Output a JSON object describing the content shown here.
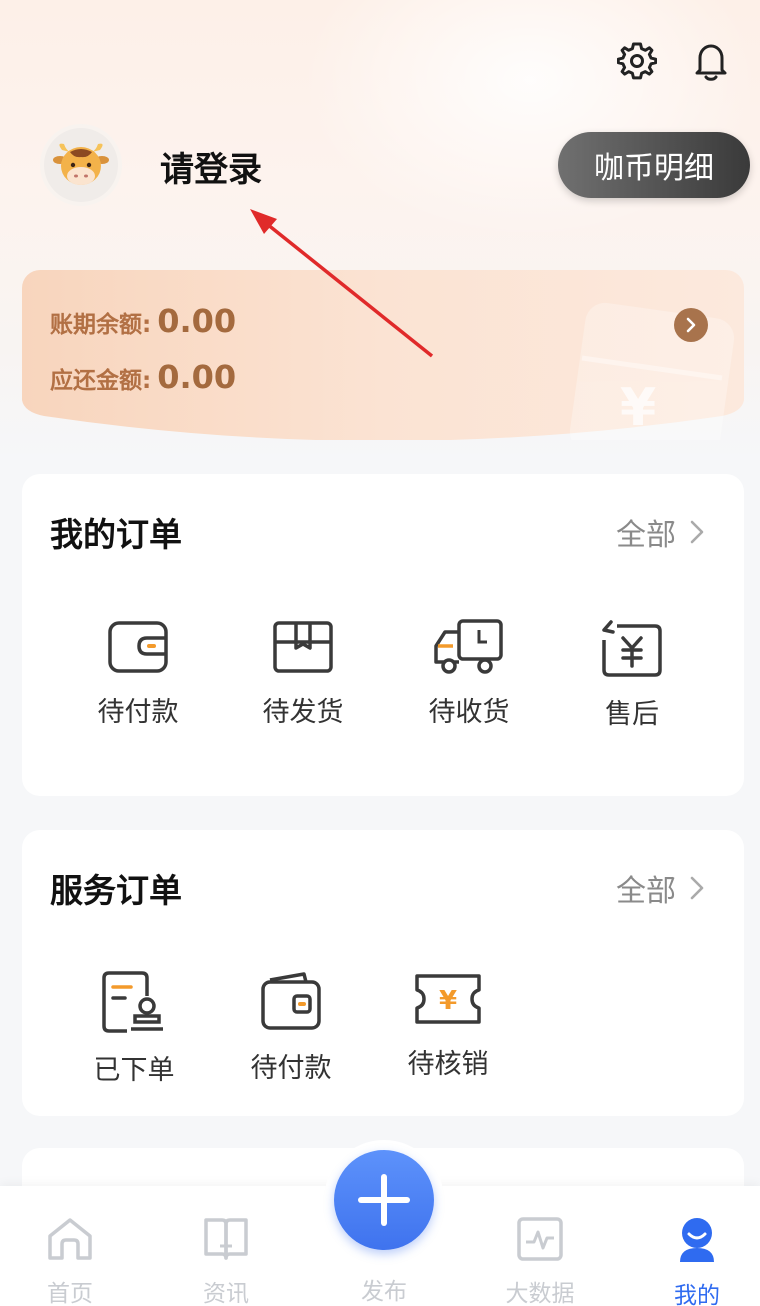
{
  "header": {
    "settings_icon": "gear-icon",
    "notification_icon": "bell-icon",
    "avatar_icon": "cow-avatar-icon",
    "login_prompt": "请登录",
    "coin_button": "咖币明细"
  },
  "credit": {
    "period_balance_label": "账期余额:",
    "period_balance_value": "0.00",
    "repay_amount_label": "应还金额:",
    "repay_amount_value": "0.00",
    "decor_symbol": "¥"
  },
  "my_orders": {
    "title": "我的订单",
    "all_label": "全部",
    "items": [
      {
        "label": "待付款",
        "icon": "wallet-icon"
      },
      {
        "label": "待发货",
        "icon": "box-icon"
      },
      {
        "label": "待收货",
        "icon": "truck-icon"
      },
      {
        "label": "售后",
        "icon": "refund-icon"
      }
    ]
  },
  "service_orders": {
    "title": "服务订单",
    "all_label": "全部",
    "items": [
      {
        "label": "已下单",
        "icon": "stamp-document-icon"
      },
      {
        "label": "待付款",
        "icon": "wallet-icon"
      },
      {
        "label": "待核销",
        "icon": "ticket-icon",
        "symbol": "¥"
      }
    ]
  },
  "tabbar": {
    "items": [
      {
        "label": "首页",
        "icon": "home-icon"
      },
      {
        "label": "资讯",
        "icon": "book-icon"
      },
      {
        "label": "发布",
        "icon": "plus-icon"
      },
      {
        "label": "大数据",
        "icon": "chart-icon"
      },
      {
        "label": "我的",
        "icon": "user-icon",
        "active": true
      }
    ]
  },
  "colors": {
    "accent_blue": "#2f6bf0",
    "icon_orange": "#f39a2b",
    "credit_text": "#a46a3e",
    "annotation_arrow": "#e02a2a"
  }
}
